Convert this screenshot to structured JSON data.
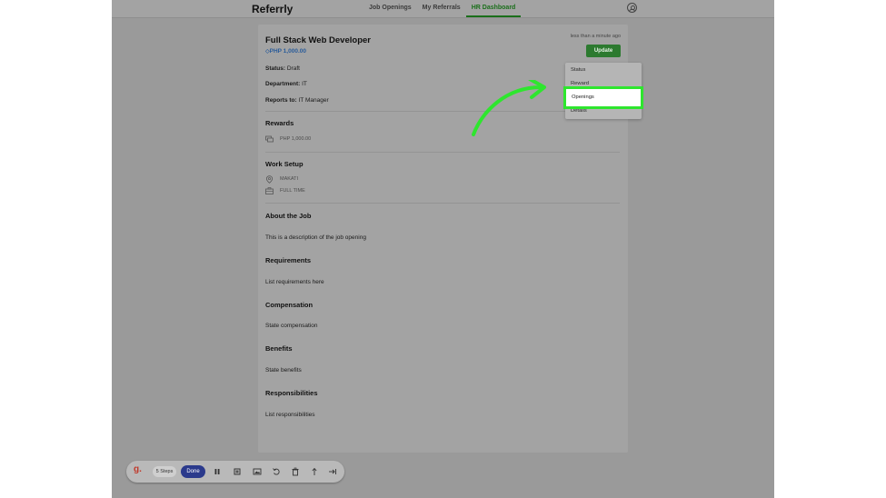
{
  "app": {
    "brand": "Referrly",
    "nav": [
      {
        "label": "Job Openings"
      },
      {
        "label": "My Referrals"
      },
      {
        "label": "HR Dashboard",
        "active": true
      }
    ]
  },
  "job": {
    "title": "Full Stack Web Developer",
    "reward": "PHP 1,000.00",
    "timestamp": "less than a minute ago",
    "update_label": "Update",
    "status_label": "Status:",
    "status_value": "Draft",
    "department_label": "Department:",
    "department_value": "IT",
    "reports_label": "Reports to:",
    "reports_value": "IT Manager",
    "rewards_heading": "Rewards",
    "rewards_value": "PHP 1,000.00",
    "work_setup_heading": "Work Setup",
    "location": "MAKATI",
    "employment": "FULL TIME",
    "about_heading": "About the Job",
    "about_text": "This is a description of the job opening",
    "requirements_heading": "Requirements",
    "requirements_text": "List requirements here",
    "compensation_heading": "Compensation",
    "compensation_text": "State compensation",
    "benefits_heading": "Benefits",
    "benefits_text": "State benefits",
    "responsibilities_heading": "Responsibilities",
    "responsibilities_text": "List responsibilities"
  },
  "menu": {
    "items": [
      "Status",
      "Reward",
      "Openings",
      "Details"
    ],
    "highlighted": "Openings"
  },
  "recorder": {
    "logo": "g.",
    "steps": "5 Steps",
    "done": "Done"
  },
  "colors": {
    "accent_green": "#2c7a2f",
    "highlight_green": "#2ee62e",
    "reward_blue": "#2a5c9a",
    "done_blue": "#2b3a8c"
  }
}
